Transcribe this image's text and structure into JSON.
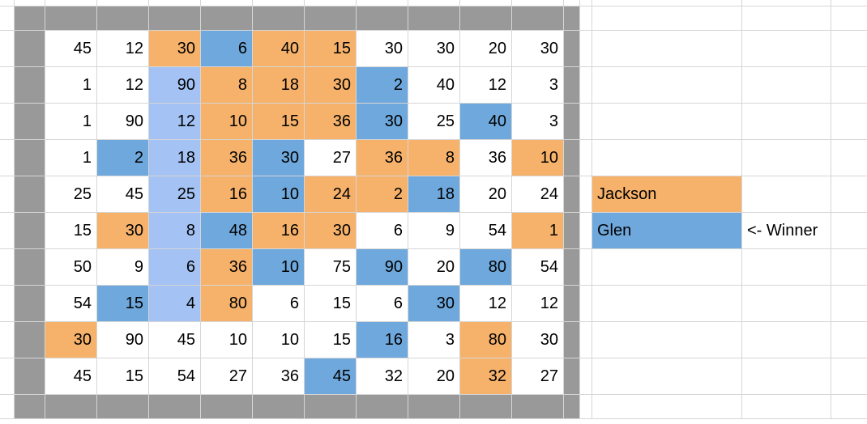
{
  "chart_data": {
    "type": "table",
    "title": "",
    "players": {
      "jackson": {
        "name": "Jackson",
        "color": "#f6b26b"
      },
      "glen": {
        "name": "Glen",
        "color": "#6fa8dc"
      }
    },
    "winner": "Glen",
    "grid": {
      "rows": 10,
      "cols": 10,
      "cells": [
        [
          {
            "v": 45,
            "c": "white"
          },
          {
            "v": 12,
            "c": "white"
          },
          {
            "v": 30,
            "c": "orange"
          },
          {
            "v": 6,
            "c": "blue"
          },
          {
            "v": 40,
            "c": "orange"
          },
          {
            "v": 15,
            "c": "orange"
          },
          {
            "v": 30,
            "c": "white"
          },
          {
            "v": 30,
            "c": "white"
          },
          {
            "v": 20,
            "c": "white"
          },
          {
            "v": 30,
            "c": "white"
          }
        ],
        [
          {
            "v": 1,
            "c": "white"
          },
          {
            "v": 12,
            "c": "white"
          },
          {
            "v": 90,
            "c": "lblue"
          },
          {
            "v": 8,
            "c": "orange"
          },
          {
            "v": 18,
            "c": "orange"
          },
          {
            "v": 30,
            "c": "orange"
          },
          {
            "v": 2,
            "c": "blue"
          },
          {
            "v": 40,
            "c": "white"
          },
          {
            "v": 12,
            "c": "white"
          },
          {
            "v": 3,
            "c": "white"
          }
        ],
        [
          {
            "v": 1,
            "c": "white"
          },
          {
            "v": 90,
            "c": "white"
          },
          {
            "v": 12,
            "c": "lblue"
          },
          {
            "v": 10,
            "c": "orange"
          },
          {
            "v": 15,
            "c": "orange"
          },
          {
            "v": 36,
            "c": "orange"
          },
          {
            "v": 30,
            "c": "blue"
          },
          {
            "v": 25,
            "c": "white"
          },
          {
            "v": 40,
            "c": "blue"
          },
          {
            "v": 3,
            "c": "white"
          }
        ],
        [
          {
            "v": 1,
            "c": "white"
          },
          {
            "v": 2,
            "c": "blue"
          },
          {
            "v": 18,
            "c": "lblue"
          },
          {
            "v": 36,
            "c": "orange"
          },
          {
            "v": 30,
            "c": "blue"
          },
          {
            "v": 27,
            "c": "white"
          },
          {
            "v": 36,
            "c": "orange"
          },
          {
            "v": 8,
            "c": "orange"
          },
          {
            "v": 36,
            "c": "white"
          },
          {
            "v": 10,
            "c": "orange"
          }
        ],
        [
          {
            "v": 25,
            "c": "white"
          },
          {
            "v": 45,
            "c": "white"
          },
          {
            "v": 25,
            "c": "lblue"
          },
          {
            "v": 16,
            "c": "orange"
          },
          {
            "v": 10,
            "c": "blue"
          },
          {
            "v": 24,
            "c": "orange"
          },
          {
            "v": 2,
            "c": "orange"
          },
          {
            "v": 18,
            "c": "blue"
          },
          {
            "v": 20,
            "c": "white"
          },
          {
            "v": 24,
            "c": "white"
          }
        ],
        [
          {
            "v": 15,
            "c": "white"
          },
          {
            "v": 30,
            "c": "orange"
          },
          {
            "v": 8,
            "c": "lblue"
          },
          {
            "v": 48,
            "c": "blue"
          },
          {
            "v": 16,
            "c": "orange"
          },
          {
            "v": 30,
            "c": "orange"
          },
          {
            "v": 6,
            "c": "white"
          },
          {
            "v": 9,
            "c": "white"
          },
          {
            "v": 54,
            "c": "white"
          },
          {
            "v": 1,
            "c": "orange"
          }
        ],
        [
          {
            "v": 50,
            "c": "white"
          },
          {
            "v": 9,
            "c": "white"
          },
          {
            "v": 6,
            "c": "lblue"
          },
          {
            "v": 36,
            "c": "orange"
          },
          {
            "v": 10,
            "c": "blue"
          },
          {
            "v": 75,
            "c": "white"
          },
          {
            "v": 90,
            "c": "blue"
          },
          {
            "v": 20,
            "c": "white"
          },
          {
            "v": 80,
            "c": "blue"
          },
          {
            "v": 54,
            "c": "white"
          }
        ],
        [
          {
            "v": 54,
            "c": "white"
          },
          {
            "v": 15,
            "c": "blue"
          },
          {
            "v": 4,
            "c": "lblue"
          },
          {
            "v": 80,
            "c": "orange"
          },
          {
            "v": 6,
            "c": "white"
          },
          {
            "v": 15,
            "c": "white"
          },
          {
            "v": 6,
            "c": "white"
          },
          {
            "v": 30,
            "c": "blue"
          },
          {
            "v": 12,
            "c": "white"
          },
          {
            "v": 12,
            "c": "white"
          }
        ],
        [
          {
            "v": 30,
            "c": "orange"
          },
          {
            "v": 90,
            "c": "white"
          },
          {
            "v": 45,
            "c": "white"
          },
          {
            "v": 10,
            "c": "white"
          },
          {
            "v": 10,
            "c": "white"
          },
          {
            "v": 15,
            "c": "white"
          },
          {
            "v": 16,
            "c": "blue"
          },
          {
            "v": 3,
            "c": "white"
          },
          {
            "v": 80,
            "c": "orange"
          },
          {
            "v": 30,
            "c": "white"
          }
        ],
        [
          {
            "v": 45,
            "c": "white"
          },
          {
            "v": 15,
            "c": "white"
          },
          {
            "v": 54,
            "c": "white"
          },
          {
            "v": 27,
            "c": "white"
          },
          {
            "v": 36,
            "c": "white"
          },
          {
            "v": 45,
            "c": "blue"
          },
          {
            "v": 32,
            "c": "white"
          },
          {
            "v": 20,
            "c": "white"
          },
          {
            "v": 32,
            "c": "orange"
          },
          {
            "v": 27,
            "c": "white"
          }
        ]
      ]
    }
  },
  "legend": {
    "jackson_label": "Jackson",
    "glen_label": "Glen",
    "winner_label": "<- Winner"
  }
}
